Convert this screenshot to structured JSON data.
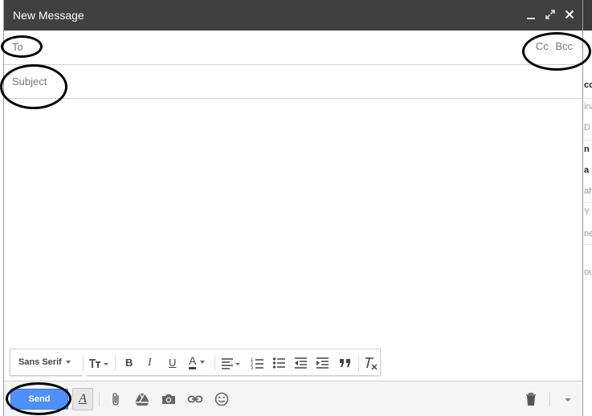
{
  "window": {
    "title": "New Message",
    "controls": [
      "minimize-icon",
      "pop-out-icon",
      "close-icon"
    ]
  },
  "to_row": {
    "label": "To",
    "cc_label": "Cc",
    "bcc_label": "Bcc"
  },
  "subject_row": {
    "label": "Subject"
  },
  "formatting": {
    "font": "Sans Serif",
    "tools": [
      "text-size-icon",
      "bold-icon",
      "italic-icon",
      "underline-icon",
      "text-color-icon",
      "align-icon",
      "numbered-list-icon",
      "bulleted-list-icon",
      "indent-less-icon",
      "indent-more-icon",
      "quote-icon",
      "remove-formatting-icon"
    ],
    "bold_glyph": "B",
    "italic_glyph": "I",
    "underline_glyph": "U",
    "text_color_glyph": "A"
  },
  "bottom_bar": {
    "send_label": "Send",
    "format_toggle_glyph": "A",
    "tools": [
      "attach-icon",
      "drive-icon",
      "photo-icon",
      "link-icon",
      "emoji-icon"
    ],
    "discard": "trash-icon",
    "more": "more-options-icon"
  },
  "background": {
    "snippets": [
      "co",
      "ina",
      "D",
      "n",
      "a",
      "ah",
      "Y",
      "ne",
      "ou"
    ]
  },
  "colors": {
    "titlebar": "#404040",
    "send": "#4d90fe",
    "annotation": "#000000"
  }
}
